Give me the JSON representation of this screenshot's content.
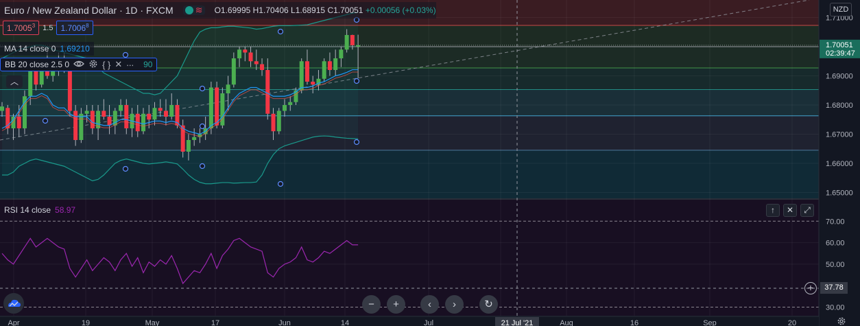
{
  "header": {
    "symbol": "Euro / New Zealand Dollar",
    "interval": "1D",
    "exchange": "FXCM",
    "open": "O1.69995",
    "high": "H1.70406",
    "low": "L1.68915",
    "close": "C1.70051",
    "change": "+0.00056 (+0.03%)"
  },
  "trading": {
    "bid": "1.7005",
    "bid_sup": "3",
    "spread": "1.5",
    "ask": "1.7006",
    "ask_sup": "8"
  },
  "indicators": {
    "ma": {
      "label": "MA 14 close 0",
      "value": "1.69210"
    },
    "bb": {
      "label": "BB 20 close 2.5 0",
      "value_tail": "90"
    },
    "rsi": {
      "label": "RSI 14 close",
      "value": "58.97",
      "last_tag": "37.78"
    }
  },
  "price_scale": {
    "currency": "NZD",
    "labels": [
      "1.71000",
      "1.70000",
      "1.69000",
      "1.68000",
      "1.67000",
      "1.66000",
      "1.65000"
    ],
    "last_price": "1.70051",
    "countdown": "02:39:47",
    "rsi_labels": [
      "70.00",
      "60.00",
      "50.00",
      "30.00"
    ],
    "rsi_partial": "40.00"
  },
  "time_axis": {
    "labels": [
      "Apr",
      "19",
      "May",
      "17",
      "Jun",
      "14",
      "Jul",
      "Aug",
      "16",
      "Sep",
      "20"
    ],
    "crosshair_label": "21 Jul '21"
  },
  "icons": {
    "eye": "eye-icon",
    "gear": "gear-icon",
    "braces": "braces-icon",
    "close": "close-icon",
    "more": "more-icon",
    "up": "chevron-up-icon",
    "minus": "zoom-out-icon",
    "plus": "zoom-in-icon",
    "left": "scroll-left-icon",
    "right": "scroll-right-icon",
    "reset": "reset-icon"
  },
  "colors": {
    "bull": "#26a69a",
    "bear": "#ef5350",
    "bull_body": "#4caf50",
    "bear_body": "#f23645",
    "ma": "#2196f3",
    "bb": "#1a9a8c",
    "rsi": "#9c27b0",
    "background": "#131722"
  },
  "chart_data": {
    "type": "candlestick",
    "y_range": [
      1.648,
      1.716
    ],
    "rsi_range": [
      26,
      80
    ],
    "candles": [
      [
        1.678,
        1.681,
        1.676,
        1.6795
      ],
      [
        1.679,
        1.68,
        1.67,
        1.672
      ],
      [
        1.672,
        1.677,
        1.668,
        1.676
      ],
      [
        1.676,
        1.68,
        1.669,
        1.672
      ],
      [
        1.672,
        1.685,
        1.67,
        1.683
      ],
      [
        1.683,
        1.695,
        1.68,
        1.692
      ],
      [
        1.692,
        1.694,
        1.685,
        1.687
      ],
      [
        1.687,
        1.696,
        1.686,
        1.694
      ],
      [
        1.694,
        1.699,
        1.689,
        1.69
      ],
      [
        1.69,
        1.696,
        1.688,
        1.692
      ],
      [
        1.692,
        1.698,
        1.69,
        1.695
      ],
      [
        1.695,
        1.698,
        1.691,
        1.693
      ],
      [
        1.693,
        1.695,
        1.676,
        1.678
      ],
      [
        1.678,
        1.68,
        1.666,
        1.668
      ],
      [
        1.668,
        1.679,
        1.667,
        1.677
      ],
      [
        1.677,
        1.68,
        1.674,
        1.678
      ],
      [
        1.678,
        1.68,
        1.67,
        1.672
      ],
      [
        1.672,
        1.68,
        1.668,
        1.678
      ],
      [
        1.678,
        1.682,
        1.675,
        1.676
      ],
      [
        1.676,
        1.68,
        1.67,
        1.673
      ],
      [
        1.673,
        1.679,
        1.67,
        1.678
      ],
      [
        1.678,
        1.682,
        1.676,
        1.68
      ],
      [
        1.68,
        1.682,
        1.67,
        1.672
      ],
      [
        1.672,
        1.679,
        1.669,
        1.677
      ],
      [
        1.677,
        1.68,
        1.669,
        1.671
      ],
      [
        1.671,
        1.679,
        1.67,
        1.677
      ],
      [
        1.677,
        1.68,
        1.672,
        1.675
      ],
      [
        1.675,
        1.681,
        1.673,
        1.679
      ],
      [
        1.679,
        1.682,
        1.676,
        1.678
      ],
      [
        1.678,
        1.682,
        1.673,
        1.676
      ],
      [
        1.676,
        1.684,
        1.675,
        1.68
      ],
      [
        1.68,
        1.682,
        1.672,
        1.673
      ],
      [
        1.673,
        1.675,
        1.662,
        1.664
      ],
      [
        1.664,
        1.67,
        1.661,
        1.668
      ],
      [
        1.668,
        1.672,
        1.666,
        1.669
      ],
      [
        1.669,
        1.672,
        1.667,
        1.67
      ],
      [
        1.67,
        1.676,
        1.668,
        1.672
      ],
      [
        1.672,
        1.688,
        1.67,
        1.686
      ],
      [
        1.686,
        1.688,
        1.672,
        1.673
      ],
      [
        1.673,
        1.686,
        1.672,
        1.684
      ],
      [
        1.684,
        1.69,
        1.678,
        1.687
      ],
      [
        1.687,
        1.698,
        1.686,
        1.696
      ],
      [
        1.696,
        1.7,
        1.693,
        1.699
      ],
      [
        1.699,
        1.7,
        1.695,
        1.698
      ],
      [
        1.698,
        1.7,
        1.693,
        1.695
      ],
      [
        1.695,
        1.699,
        1.692,
        1.694
      ],
      [
        1.694,
        1.696,
        1.69,
        1.692
      ],
      [
        1.692,
        1.696,
        1.675,
        1.677
      ],
      [
        1.677,
        1.679,
        1.668,
        1.671
      ],
      [
        1.671,
        1.679,
        1.67,
        1.678
      ],
      [
        1.678,
        1.682,
        1.676,
        1.68
      ],
      [
        1.68,
        1.683,
        1.678,
        1.681
      ],
      [
        1.681,
        1.686,
        1.68,
        1.685
      ],
      [
        1.685,
        1.696,
        1.684,
        1.695
      ],
      [
        1.695,
        1.699,
        1.687,
        1.688
      ],
      [
        1.688,
        1.69,
        1.684,
        1.687
      ],
      [
        1.687,
        1.692,
        1.685,
        1.689
      ],
      [
        1.689,
        1.696,
        1.688,
        1.695
      ],
      [
        1.695,
        1.698,
        1.69,
        1.692
      ],
      [
        1.692,
        1.699,
        1.69,
        1.696
      ],
      [
        1.696,
        1.7,
        1.693,
        1.699
      ],
      [
        1.699,
        1.706,
        1.698,
        1.704
      ],
      [
        1.704,
        1.7041,
        1.699,
        1.7005
      ],
      [
        1.7,
        1.7041,
        1.6892,
        1.7005
      ]
    ],
    "ma": [
      1.672,
      1.673,
      1.675,
      1.678,
      1.681,
      1.683,
      1.683,
      1.684,
      1.683,
      1.68,
      1.679,
      1.679,
      1.677,
      1.676,
      1.676,
      1.676,
      1.674,
      1.6735,
      1.673,
      1.673,
      1.674,
      1.675,
      1.675,
      1.6745,
      1.674,
      1.6735,
      1.674,
      1.6745,
      1.6745,
      1.674,
      1.6745,
      1.674,
      1.672,
      1.671,
      1.6705,
      1.67,
      1.671,
      1.673,
      1.674,
      1.676,
      1.679,
      1.682,
      1.684,
      1.685,
      1.686,
      1.686,
      1.685,
      1.684,
      1.683,
      1.683,
      1.683,
      1.6835,
      1.6845,
      1.686,
      1.686,
      1.6865,
      1.6875,
      1.688,
      1.689,
      1.69,
      1.6905,
      1.6912,
      1.6921,
      1.6921
    ],
    "bb_upper": [
      1.696,
      1.697,
      1.698,
      1.699,
      1.6995,
      1.7,
      1.7005,
      1.7005,
      1.7,
      1.699,
      1.6985,
      1.698,
      1.6975,
      1.697,
      1.6965,
      1.696,
      1.695,
      1.693,
      1.691,
      1.69,
      1.689,
      1.688,
      1.687,
      1.686,
      1.685,
      1.684,
      1.684,
      1.6835,
      1.684,
      1.686,
      1.688,
      1.69,
      1.694,
      1.698,
      1.702,
      1.705,
      1.706,
      1.7065,
      1.7065,
      1.7068,
      1.707,
      1.707,
      1.7068,
      1.7066,
      1.7064,
      1.706,
      1.7062,
      1.7066,
      1.707,
      1.7072,
      1.7072,
      1.7072,
      1.7073,
      1.7074,
      1.7075,
      1.708,
      1.7085,
      1.709,
      1.7095,
      1.71,
      1.7105,
      1.711,
      1.7115,
      1.7118
    ],
    "bb_lower": [
      1.656,
      1.656,
      1.657,
      1.659,
      1.66,
      1.661,
      1.6615,
      1.661,
      1.6605,
      1.66,
      1.6595,
      1.659,
      1.658,
      1.657,
      1.656,
      1.655,
      1.654,
      1.6545,
      1.656,
      1.658,
      1.66,
      1.661,
      1.6615,
      1.661,
      1.6605,
      1.66,
      1.6598,
      1.66,
      1.6602,
      1.6605,
      1.6602,
      1.6598,
      1.658,
      1.656,
      1.6545,
      1.6535,
      1.653,
      1.653,
      1.6532,
      1.6534,
      1.6534,
      1.6532,
      1.6533,
      1.6534,
      1.6534,
      1.6536,
      1.656,
      1.66,
      1.663,
      1.665,
      1.666,
      1.6666,
      1.6672,
      1.6678,
      1.6684,
      1.669,
      1.6693,
      1.6694,
      1.6693,
      1.669,
      1.6688,
      1.6686,
      1.6685,
      1.6684
    ],
    "rsi": [
      55,
      52,
      50,
      54,
      58,
      62,
      58,
      60,
      62,
      60,
      58,
      57,
      48,
      44,
      48,
      52,
      47,
      50,
      53,
      51,
      47,
      52,
      55,
      49,
      53,
      46,
      51,
      49,
      52,
      50,
      54,
      48,
      41,
      44,
      47,
      46,
      50,
      55,
      48,
      54,
      57,
      61,
      62,
      60,
      58,
      57,
      56,
      46,
      44,
      48,
      50,
      51,
      53,
      58,
      52,
      51,
      53,
      56,
      55,
      57,
      59,
      61,
      59,
      59
    ],
    "levels": [
      1.7073,
      1.7,
      1.6927,
      1.6853,
      1.6763,
      1.6645
    ]
  }
}
